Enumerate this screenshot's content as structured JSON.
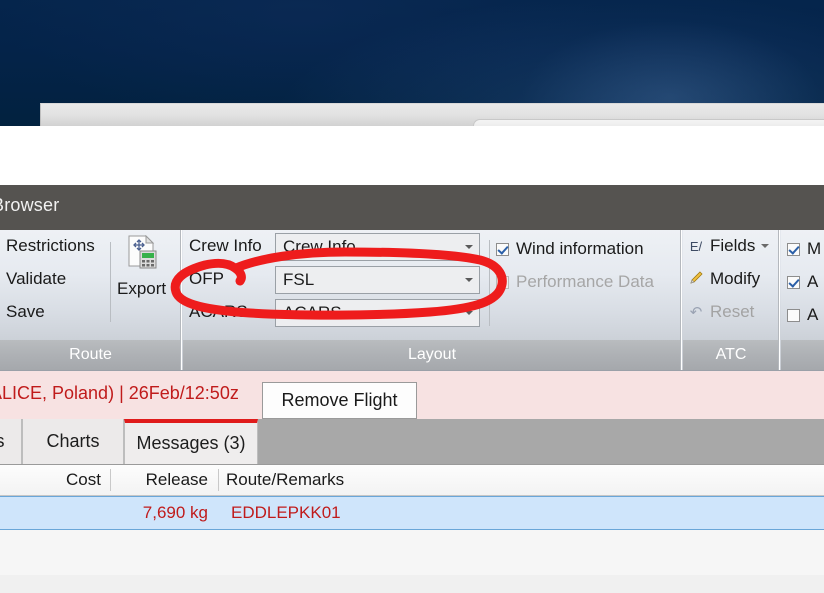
{
  "window": {
    "title": "Browser"
  },
  "ribbon": {
    "groups": [
      {
        "name": "Route",
        "label": "Route",
        "commands": [
          "Restrictions",
          "Validate",
          "Save"
        ],
        "export_label": "Export",
        "export_icon": "document-calculator-icon"
      },
      {
        "name": "Layout",
        "label": "Layout",
        "rows": [
          {
            "label": "Crew Info",
            "value": "Crew Info"
          },
          {
            "label": "OFP",
            "value": "FSL"
          },
          {
            "label": "ACARS",
            "value": "ACARS"
          }
        ],
        "checkboxes": [
          {
            "label": "Wind information",
            "checked": true,
            "disabled": false
          },
          {
            "label": "Performance Data",
            "checked": false,
            "disabled": true
          }
        ]
      },
      {
        "name": "ATC",
        "label": "ATC",
        "items": [
          {
            "label": "Fields",
            "glyph": "E/",
            "icon": "fields-icon",
            "disabled": false,
            "dropdown": true
          },
          {
            "label": "Modify",
            "glyph": "✎",
            "icon": "pencil-icon",
            "disabled": false,
            "dropdown": false
          },
          {
            "label": "Reset",
            "glyph": "↶",
            "icon": "undo-icon",
            "disabled": true,
            "dropdown": false
          }
        ]
      },
      {
        "name": "Messages",
        "label": "",
        "checkboxes": [
          {
            "label": "M",
            "checked": true,
            "disabled": false
          },
          {
            "label": "A",
            "checked": true,
            "disabled": false
          },
          {
            "label": "A",
            "checked": false,
            "disabled": false
          }
        ]
      }
    ]
  },
  "flight_bar": {
    "text": "ALICE, Poland) | 26Feb/12:50z",
    "remove_button": "Remove Flight",
    "background_color": "#f7e2e2",
    "text_color": "#c01b1b"
  },
  "tabs": [
    {
      "label": "s",
      "active": false
    },
    {
      "label": "Charts",
      "active": false
    },
    {
      "label": "Messages (3)",
      "active": true
    }
  ],
  "table": {
    "headers": [
      "Cost",
      "Release",
      "Route/Remarks"
    ],
    "rows": [
      {
        "cost": "",
        "release": "7,690 kg",
        "route": "EDDLEPKK01",
        "selected": true
      }
    ],
    "row_highlight_color": "#cfe5fb",
    "value_color": "#c01b1b"
  },
  "annotation": {
    "type": "hand-drawn-oval",
    "color": "#ee1c1c",
    "stroke_width": 9,
    "target": "OFP / FSL layout row"
  }
}
